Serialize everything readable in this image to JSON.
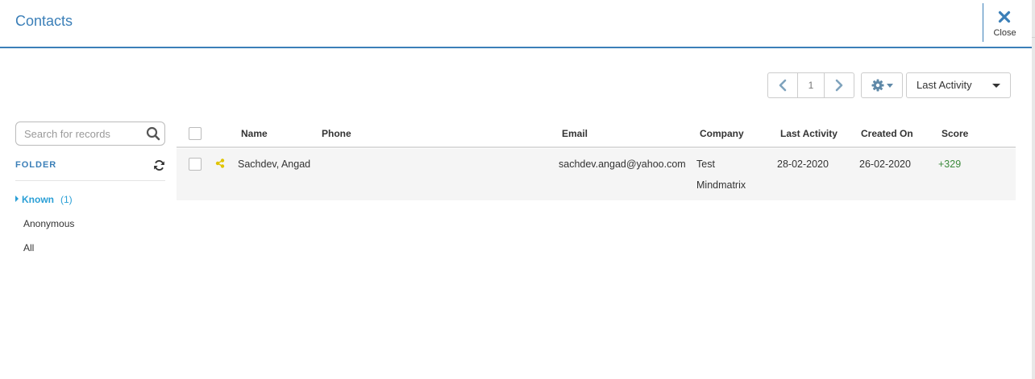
{
  "header": {
    "title": "Contacts",
    "close_label": "Close"
  },
  "toolbar": {
    "page": "1",
    "sort_by": "Last Activity"
  },
  "search": {
    "placeholder": "Search for records",
    "value": ""
  },
  "folder": {
    "heading": "FOLDER",
    "items": [
      {
        "label": "Known",
        "count": "(1)",
        "active": true
      },
      {
        "label": "Anonymous"
      },
      {
        "label": "All"
      }
    ]
  },
  "grid": {
    "columns": [
      "Name",
      "Phone",
      "Email",
      "Company",
      "Last Activity",
      "Created On",
      "Score"
    ],
    "rows": [
      {
        "name": "Sachdev, Angad",
        "phone": "",
        "email": "sachdev.angad@yahoo.com",
        "company_line1": "Test",
        "company_line2": "Mindmatrix",
        "last_activity": "28-02-2020",
        "created_on": "26-02-2020",
        "score": "+329"
      }
    ]
  },
  "colors": {
    "accent": "#3b7fb8",
    "active_folder": "#2a9fd6",
    "score": "#3c8a3c",
    "share_icon": "#e0c400"
  }
}
